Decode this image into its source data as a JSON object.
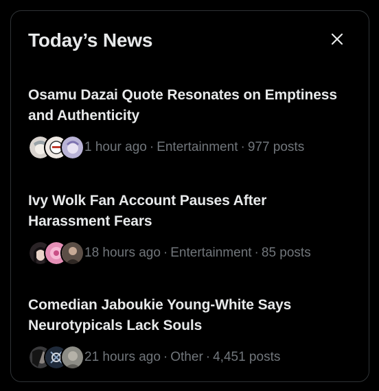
{
  "panel": {
    "title": "Today’s News",
    "close_icon": "close-icon"
  },
  "news": [
    {
      "headline": "Osamu Dazai Quote Resonates on Emptiness and Authenticity",
      "time": "1 hour ago",
      "category": "Entertainment",
      "posts": "977 posts"
    },
    {
      "headline": "Ivy Wolk Fan Account Pauses After Harassment Fears",
      "time": "18 hours ago",
      "category": "Entertainment",
      "posts": "85 posts"
    },
    {
      "headline": "Comedian Jaboukie Young-White Says Neurotypicals Lack Souls",
      "time": "21 hours ago",
      "category": "Other",
      "posts": "4,451 posts"
    }
  ],
  "separator": "·",
  "colors": {
    "background": "#000000",
    "primary_text": "#e7e9ea",
    "secondary_text": "#71767b",
    "border": "#2f3336"
  }
}
